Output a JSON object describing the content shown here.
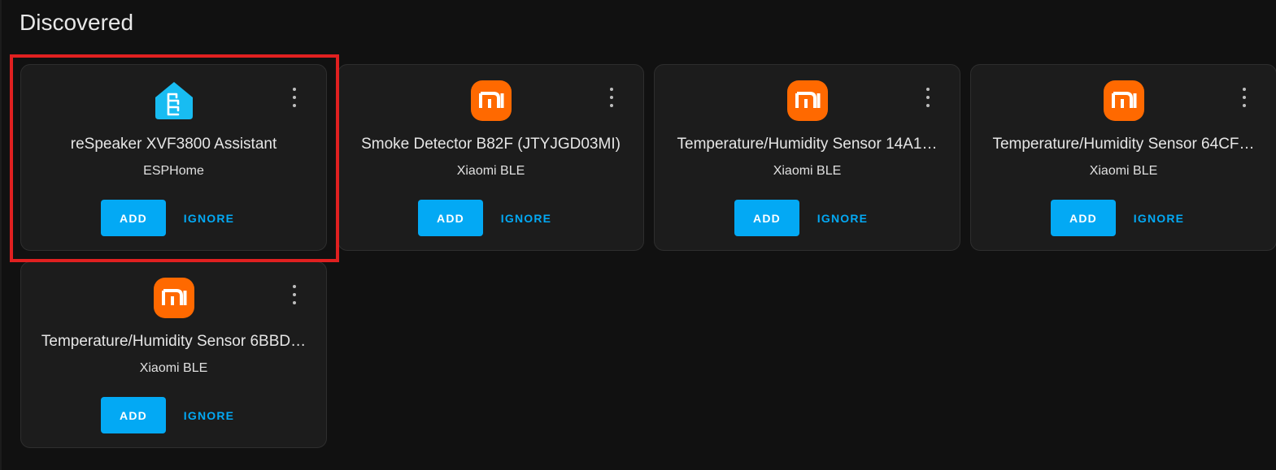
{
  "section": {
    "title": "Discovered"
  },
  "colors": {
    "background": "#111111",
    "card": "#1c1c1c",
    "accent": "#03a9f4",
    "xiaomi_orange": "#ff6900",
    "esphome_blue": "#18bcf2",
    "highlight": "#e02020"
  },
  "cards": [
    {
      "name": "reSpeaker XVF3800 Assistant",
      "integration": "ESPHome",
      "icon": "esphome-icon",
      "add_label": "ADD",
      "ignore_label": "IGNORE",
      "highlighted": true
    },
    {
      "name": "Smoke Detector B82F (JTYJGD03MI)",
      "integration": "Xiaomi BLE",
      "icon": "xiaomi-icon",
      "add_label": "ADD",
      "ignore_label": "IGNORE"
    },
    {
      "name": "Temperature/Humidity Sensor 14A1…",
      "integration": "Xiaomi BLE",
      "icon": "xiaomi-icon",
      "add_label": "ADD",
      "ignore_label": "IGNORE"
    },
    {
      "name": "Temperature/Humidity Sensor 64CF…",
      "integration": "Xiaomi BLE",
      "icon": "xiaomi-icon",
      "add_label": "ADD",
      "ignore_label": "IGNORE"
    },
    {
      "name": "Temperature/Humidity Sensor 6BBD…",
      "integration": "Xiaomi BLE",
      "icon": "xiaomi-icon",
      "add_label": "ADD",
      "ignore_label": "IGNORE"
    }
  ]
}
